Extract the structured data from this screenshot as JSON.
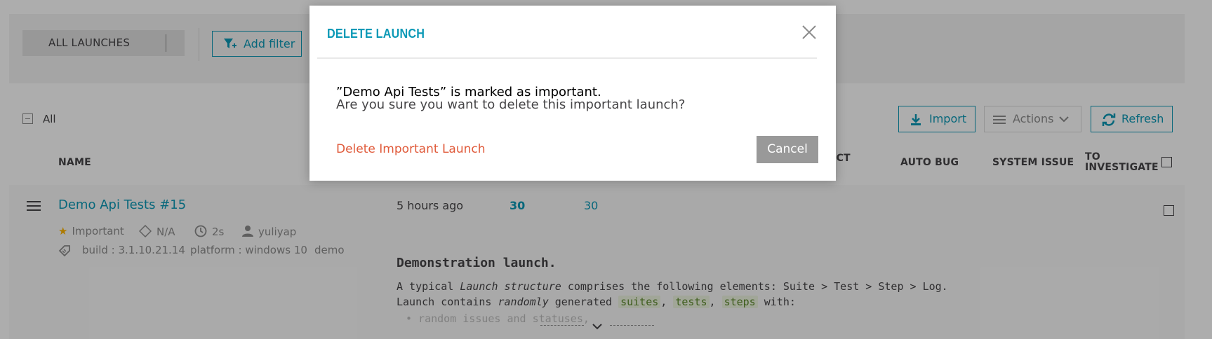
{
  "filters": {
    "tab_all_label": "ALL LAUNCHES",
    "add_filter_label": "Add filter"
  },
  "toolbar": {
    "select_all_label": "All",
    "import_label": "Import",
    "actions_label": "Actions",
    "refresh_label": "Refresh"
  },
  "table": {
    "headers": {
      "name": "NAME",
      "product": "UCT",
      "auto_bug": "AUTO BUG",
      "system_issue": "SYSTEM ISSUE",
      "to_investigate_1": "TO",
      "to_investigate_2": "INVESTIGATE"
    },
    "row": {
      "name": "Demo Api Tests #15",
      "important": "Important",
      "na": "N/A",
      "duration": "2s",
      "user": "yuliyap",
      "attr_build": "build : 3.1.10.21.14",
      "attr_platform": "platform : windows 10",
      "attr_demo": "demo",
      "start_time": "5 hours ago",
      "total": "30",
      "passed": "30",
      "description": {
        "title": "Demonstration launch.",
        "line1_a": "A typical ",
        "line1_em": "Launch structure",
        "line1_b": " comprises the following elements: Suite > Test > Step > Log.",
        "line2_a": "Launch contains ",
        "line2_em": "randomly",
        "line2_b": " generated ",
        "code_suites": "suites",
        "comma1": ", ",
        "code_tests": "tests",
        "comma2": ", ",
        "code_steps": "steps",
        "line2_c": " with:",
        "line3": "• random issues and statuses,"
      }
    }
  },
  "modal": {
    "title": "DELETE LAUNCH",
    "message_line1": "”Demo Api Tests” is marked as important.",
    "message_line2": "Are you sure you want to delete this important launch?",
    "delete_label": "Delete Important Launch",
    "cancel_label": "Cancel"
  },
  "colors": {
    "accent": "#0b99b6",
    "danger": "#e05a3a",
    "important_star": "#ffb400",
    "cancel_bg": "#999999"
  }
}
